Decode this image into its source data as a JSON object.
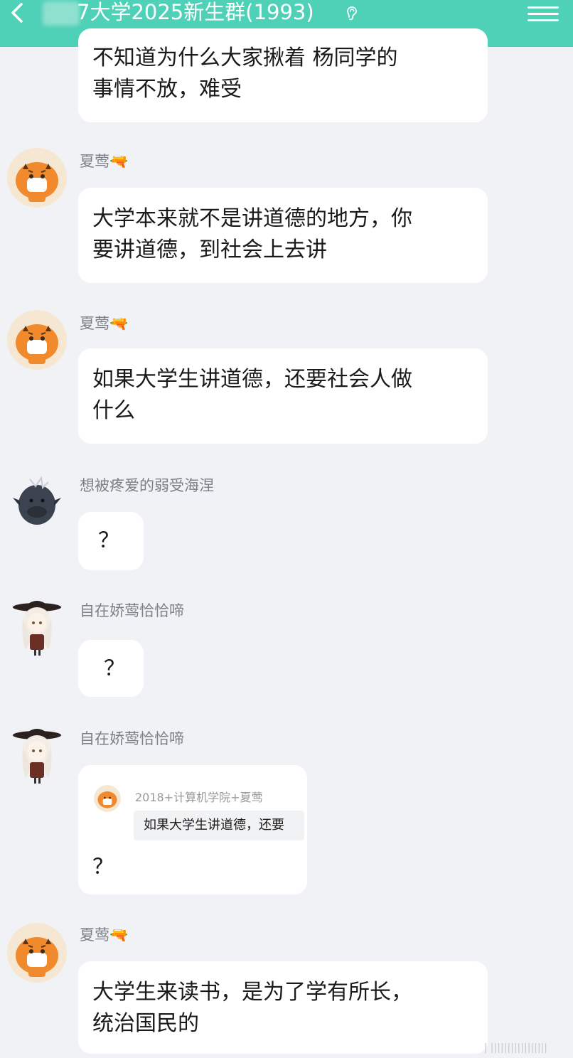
{
  "header": {
    "back_icon": "back-chevron-icon",
    "title": "7大学2025新生群(1993)",
    "ear_icon": "ear-icon",
    "menu_icon": "menu-icon",
    "bar_color": "#4fd1b8"
  },
  "messages": [
    {
      "sender": "",
      "lines": [
        "不知道为什么大家揪着 杨同学的",
        "事情不放，难受"
      ]
    },
    {
      "sender": "夏莺🔫",
      "avatar": "tiger-avatar",
      "lines": [
        "大学本来就不是讲道德的地方，你",
        "要讲道德，到社会上去讲"
      ]
    },
    {
      "sender": "夏莺🔫",
      "avatar": "tiger-avatar",
      "lines": [
        "如果大学生讲道德，还要社会人做",
        "什么"
      ]
    },
    {
      "sender": "想被疼爱的弱受海涅",
      "avatar": "creature-avatar",
      "lines": [
        "？"
      ]
    },
    {
      "sender": "自在娇莺恰恰啼",
      "avatar": "anime-girl-avatar",
      "lines": [
        "？"
      ]
    },
    {
      "sender": "自在娇莺恰恰啼",
      "avatar": "anime-girl-avatar",
      "quote": {
        "name": "2018+计算机学院+夏莺",
        "text": "如果大学生讲道德，还要"
      },
      "lines": [
        "？"
      ]
    },
    {
      "sender": "夏莺🔫",
      "avatar": "tiger-avatar",
      "lines": [
        "大学生来读书，是为了学有所长，",
        "统治国民的"
      ]
    }
  ],
  "watermark": "| |||||||||||||||||"
}
